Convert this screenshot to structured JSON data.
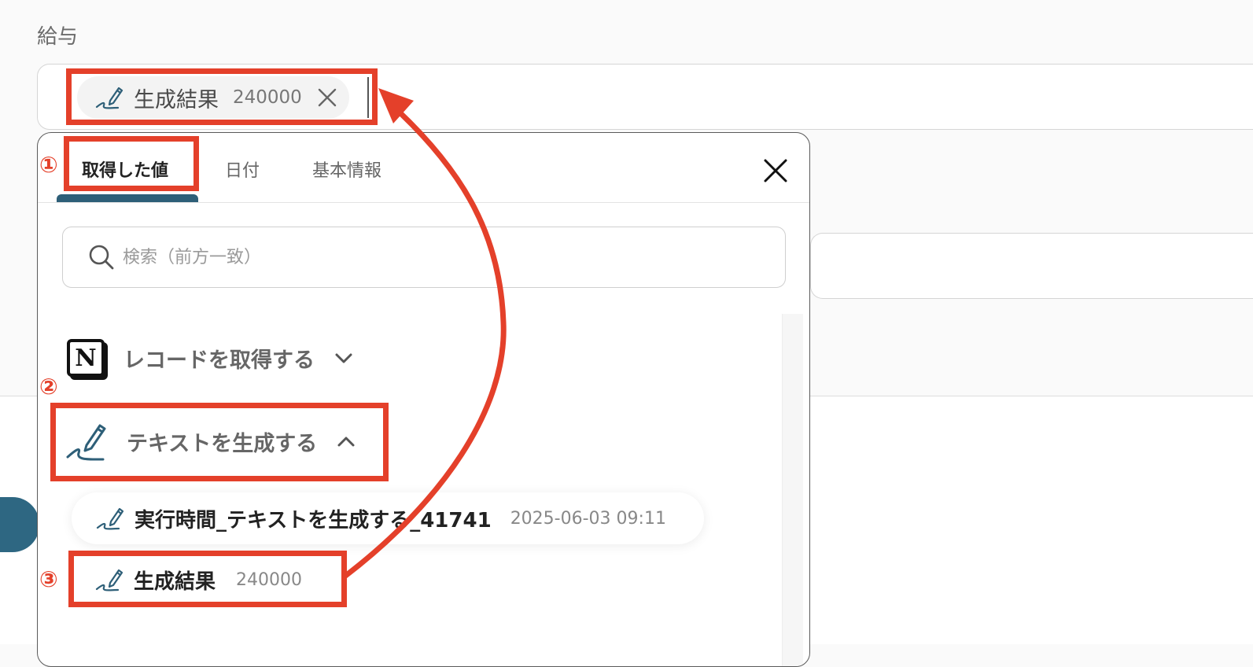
{
  "field": {
    "label": "給与",
    "chip_label": "生成結果",
    "chip_value": "240000"
  },
  "panel": {
    "tabs": [
      {
        "label": "取得した値"
      },
      {
        "label": "日付"
      },
      {
        "label": "基本情報"
      }
    ],
    "search_placeholder": "検索（前方一致）",
    "groups": [
      {
        "label": "レコードを取得する",
        "icon": "notion-logo-icon",
        "expanded": false
      },
      {
        "label": "テキストを生成する",
        "icon": "pen-signature-icon",
        "expanded": true
      }
    ],
    "items": [
      {
        "label": "実行時間_テキストを生成する_41741",
        "value": "2025-06-03 09:11"
      },
      {
        "label": "生成結果",
        "value": "240000"
      }
    ]
  },
  "annotations": {
    "step1": "①",
    "step2": "②",
    "step3": "③",
    "color": "#e4402a"
  },
  "colors": {
    "accent": "#2e6782",
    "highlight": "#e4402a"
  }
}
